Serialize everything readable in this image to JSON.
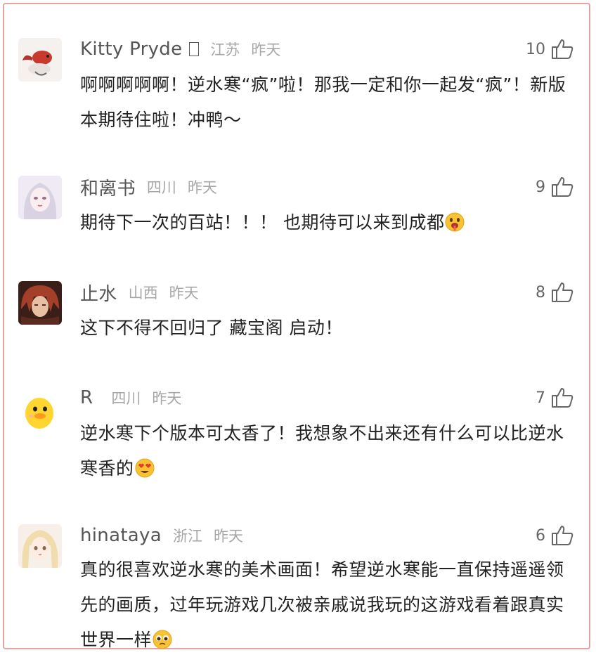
{
  "comments": [
    {
      "username": "Kitty Pryde",
      "location": "江苏",
      "time": "昨天",
      "likes": "10",
      "text": "啊啊啊啊啊！逆水寒“疯”啦！那我一定和你一起发“疯”！新版本期待住啦！冲鸭～",
      "emoji": "",
      "avatar": "koi-fish-avatar"
    },
    {
      "username": "和离书",
      "location": "四川",
      "time": "昨天",
      "likes": "9",
      "text": "期待下一次的百站！！！ 也期待可以来到成都",
      "emoji": "drooling-face-emoji",
      "avatar": "anime-girl-avatar"
    },
    {
      "username": "止水",
      "location": "山西",
      "time": "昨天",
      "likes": "8",
      "text": "这下不得不回归了 藏宝阁 启动！",
      "emoji": "",
      "avatar": "red-hair-character-avatar"
    },
    {
      "username": "R",
      "location": "四川",
      "time": "昨天",
      "likes": "7",
      "text": "逆水寒下个版本可太香了！我想象不出来还有什么可以比逆水寒香的",
      "emoji": "heart-eyes-emoji",
      "avatar": "yellow-duck-avatar"
    },
    {
      "username": "hinataya",
      "location": "浙江",
      "time": "昨天",
      "likes": "6",
      "text": "真的很喜欢逆水寒的美术画面！希望逆水寒能一直保持遥遥领先的画质，过年玩游戏几次被亲戚说我玩的这游戏看着跟真实世界一样",
      "emoji": "pleading-face-emoji",
      "avatar": "blonde-girl-avatar"
    }
  ],
  "colors": {
    "border": "#e5a3a3",
    "username": "#555555",
    "meta": "#a7a7a7",
    "text": "#222222"
  },
  "icons": {
    "like": "thumbs-up-icon"
  }
}
